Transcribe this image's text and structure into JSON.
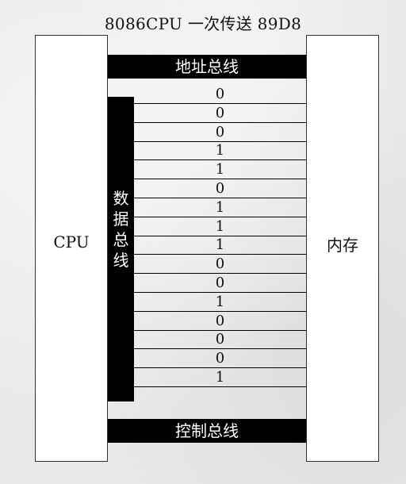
{
  "title": "8086CPU 一次传送 89D8",
  "cpu": {
    "label": "CPU"
  },
  "memory": {
    "label": "内存"
  },
  "address_bus": {
    "label": "地址总线"
  },
  "control_bus": {
    "label": "控制总线"
  },
  "data_bus": {
    "label_chars": [
      "数",
      "据",
      "总",
      "线"
    ],
    "bits": [
      "0",
      "0",
      "0",
      "1",
      "1",
      "0",
      "1",
      "1",
      "1",
      "0",
      "0",
      "1",
      "0",
      "0",
      "0",
      "1"
    ]
  },
  "colors": {
    "bus_fill": "#000000",
    "box_fill": "#ffffff",
    "background": "#e9e9e9"
  }
}
